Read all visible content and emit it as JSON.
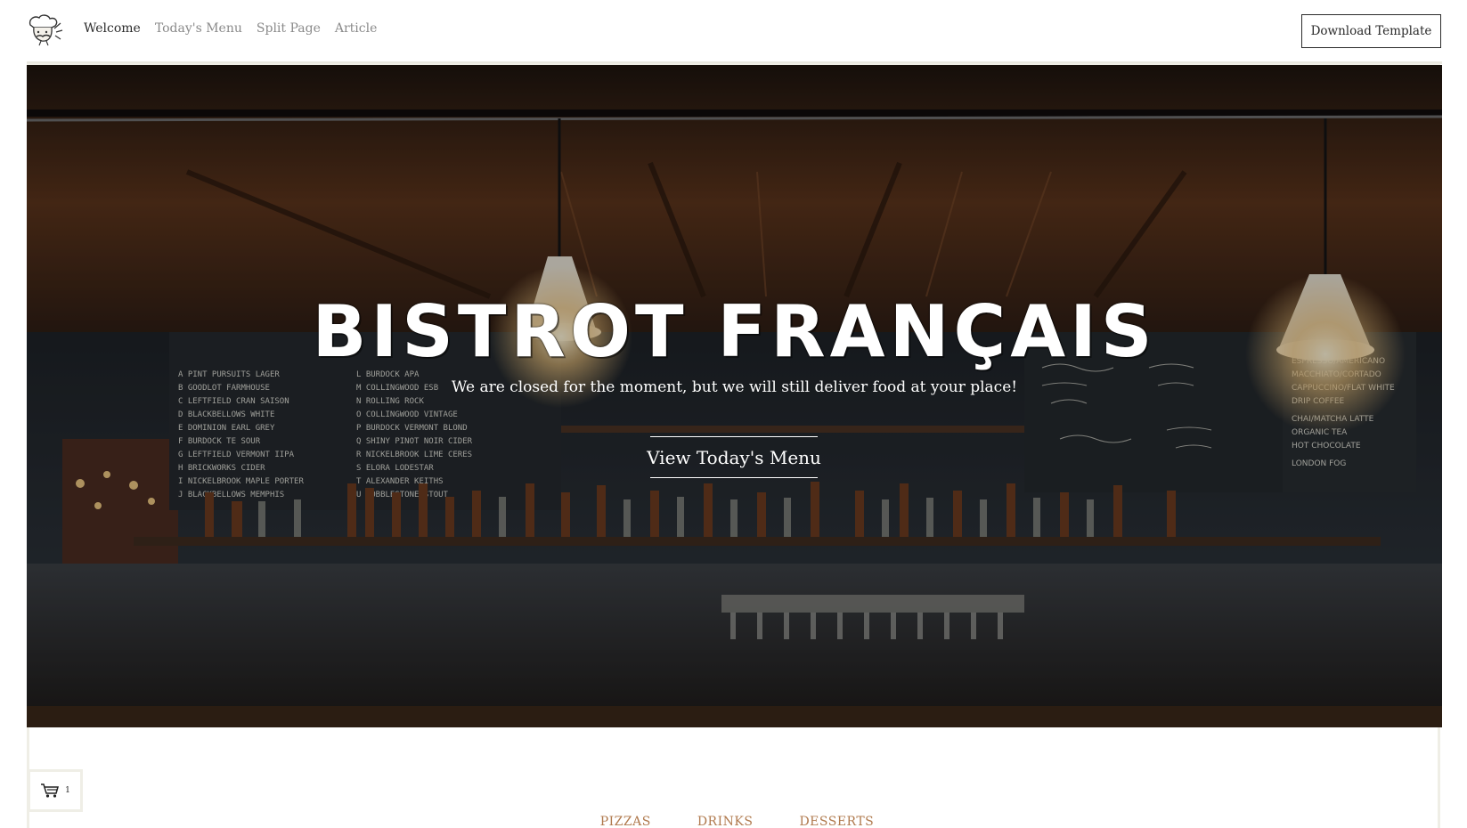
{
  "header": {
    "logo_icon": "chef-logo-icon",
    "nav": [
      {
        "label": "Welcome",
        "active": true
      },
      {
        "label": "Today's Menu",
        "active": false
      },
      {
        "label": "Split Page",
        "active": false
      },
      {
        "label": "Article",
        "active": false
      }
    ],
    "download_label": "Download Template"
  },
  "hero": {
    "title": "BISTROT FRANÇAIS",
    "subtitle": "We are closed for the moment, but we will still deliver food at your place!",
    "cta_label": "View Today's Menu",
    "background": "restaurant-bar-interior-photo"
  },
  "cart": {
    "icon": "shopping-cart-icon",
    "count": "1"
  },
  "categories": [
    "PIZZAS",
    "DRINKS",
    "DESSERTS"
  ],
  "colors": {
    "accent": "#b07a4e",
    "frame": "#efeee6",
    "button_border": "#2b2b2b"
  }
}
